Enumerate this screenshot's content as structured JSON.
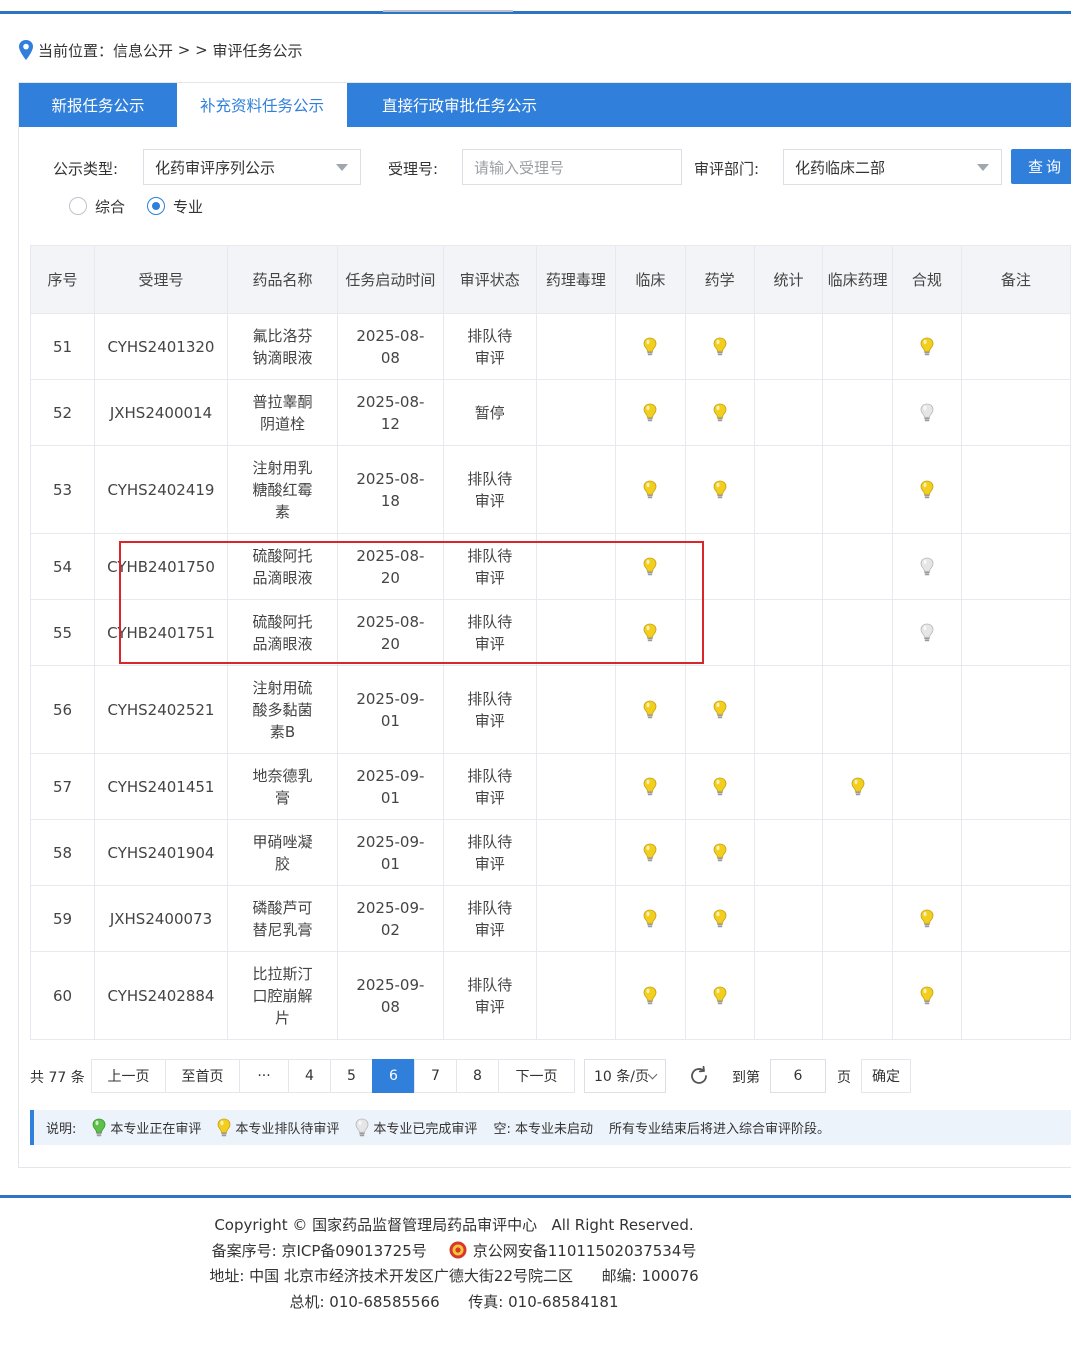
{
  "breadcrumb": {
    "label": "当前位置：",
    "item1": "信息公开",
    "sep": " > > ",
    "item2": "审评任务公示"
  },
  "tabs": [
    {
      "label": "新报任务公示",
      "active": false
    },
    {
      "label": "补充资料任务公示",
      "active": true
    },
    {
      "label": "直接行政审批任务公示",
      "active": false
    }
  ],
  "filters": {
    "type_label": "公示类型:",
    "type_value": "化药审评序列公示",
    "accept_label": "受理号:",
    "accept_placeholder": "请输入受理号",
    "dept_label": "审评部门:",
    "dept_value": "化药临床二部",
    "query_label": "查询",
    "radio_comprehensive": "综合",
    "radio_professional": "专业",
    "radio_selected": "专业"
  },
  "table": {
    "headers": [
      "序号",
      "受理号",
      "药品名称",
      "任务启动时间",
      "审评状态",
      "药理毒理",
      "临床",
      "药学",
      "统计",
      "临床药理",
      "合规",
      "备注"
    ],
    "rows": [
      {
        "no": "51",
        "id": "CYHS2401320",
        "name": "氟比洛芬钠滴眼液",
        "date": "2025-08-08",
        "status": "排队待审评",
        "ptox": "",
        "clin": "yellow",
        "pharm": "yellow",
        "stat": "",
        "cpharm": "",
        "comp": "yellow",
        "note": ""
      },
      {
        "no": "52",
        "id": "JXHS2400014",
        "name": "普拉睾酮阴道栓",
        "date": "2025-08-12",
        "status": "暂停",
        "ptox": "",
        "clin": "yellow",
        "pharm": "yellow",
        "stat": "",
        "cpharm": "",
        "comp": "white",
        "note": ""
      },
      {
        "no": "53",
        "id": "CYHS2402419",
        "name": "注射用乳糖酸红霉素",
        "date": "2025-08-18",
        "status": "排队待审评",
        "ptox": "",
        "clin": "yellow",
        "pharm": "yellow",
        "stat": "",
        "cpharm": "",
        "comp": "yellow",
        "note": ""
      },
      {
        "no": "54",
        "id": "CYHB2401750",
        "name": "硫酸阿托品滴眼液",
        "date": "2025-08-20",
        "status": "排队待审评",
        "ptox": "",
        "clin": "yellow",
        "pharm": "",
        "stat": "",
        "cpharm": "",
        "comp": "white",
        "note": ""
      },
      {
        "no": "55",
        "id": "CYHB2401751",
        "name": "硫酸阿托品滴眼液",
        "date": "2025-08-20",
        "status": "排队待审评",
        "ptox": "",
        "clin": "yellow",
        "pharm": "",
        "stat": "",
        "cpharm": "",
        "comp": "white",
        "note": ""
      },
      {
        "no": "56",
        "id": "CYHS2402521",
        "name": "注射用硫酸多黏菌素B",
        "date": "2025-09-01",
        "status": "排队待审评",
        "ptox": "",
        "clin": "yellow",
        "pharm": "yellow",
        "stat": "",
        "cpharm": "",
        "comp": "",
        "note": ""
      },
      {
        "no": "57",
        "id": "CYHS2401451",
        "name": "地奈德乳膏",
        "date": "2025-09-01",
        "status": "排队待审评",
        "ptox": "",
        "clin": "yellow",
        "pharm": "yellow",
        "stat": "",
        "cpharm": "yellow",
        "comp": "",
        "note": ""
      },
      {
        "no": "58",
        "id": "CYHS2401904",
        "name": "甲硝唑凝胶",
        "date": "2025-09-01",
        "status": "排队待审评",
        "ptox": "",
        "clin": "yellow",
        "pharm": "yellow",
        "stat": "",
        "cpharm": "",
        "comp": "",
        "note": ""
      },
      {
        "no": "59",
        "id": "JXHS2400073",
        "name": "磷酸芦可替尼乳膏",
        "date": "2025-09-02",
        "status": "排队待审评",
        "ptox": "",
        "clin": "yellow",
        "pharm": "yellow",
        "stat": "",
        "cpharm": "",
        "comp": "yellow",
        "note": ""
      },
      {
        "no": "60",
        "id": "CYHS2402884",
        "name": "比拉斯汀口腔崩解片",
        "date": "2025-09-08",
        "status": "排队待审评",
        "ptox": "",
        "clin": "yellow",
        "pharm": "yellow",
        "stat": "",
        "cpharm": "",
        "comp": "yellow",
        "note": ""
      }
    ]
  },
  "pager": {
    "total": "共 77 条",
    "prev": "上一页",
    "first": "至首页",
    "ellipsis": "···",
    "pages": [
      "4",
      "5",
      "6",
      "7",
      "8"
    ],
    "current": "6",
    "next": "下一页",
    "page_size": "10 条/页",
    "goto_label": "到第",
    "goto_value": "6",
    "page_unit": "页",
    "confirm": "确定"
  },
  "legend": {
    "title": "说明:",
    "green": "本专业正在审评",
    "yellow": "本专业排队待审评",
    "white": "本专业已完成审评",
    "empty": "空: 本专业未启动",
    "note": "所有专业结束后将进入综合审评阶段。"
  },
  "footer": {
    "copyright": "Copyright © 国家药品监督管理局药品审评中心   All Right Reserved.",
    "icp": "备案序号: 京ICP备09013725号",
    "police": "京公网安备11011502037534号",
    "address": "地址: 中国 北京市经济技术开发区广德大街22号院二区      邮编: 100076",
    "phone": "总机: 010-68585566      传真: 010-68584181"
  },
  "colors": {
    "accent": "#2f7fdb",
    "highlight": "#d9262b",
    "bulb_yellow": "#f2cf1f",
    "bulb_green": "#5cc04a",
    "bulb_white": "#e6e6e6"
  }
}
